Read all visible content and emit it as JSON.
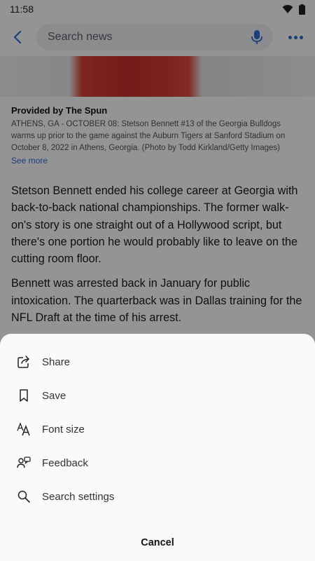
{
  "status_bar": {
    "time": "11:58"
  },
  "header": {
    "search_placeholder": "Search news"
  },
  "caption": {
    "provider": "Provided by The Spun",
    "text": "ATHENS, GA - OCTOBER 08: Stetson Bennett #13 of the Georgia Bulldogs warms up prior to the game against the Auburn Tigers at Sanford Stadium on October 8, 2022 in Athens, Georgia. (Photo by Todd Kirkland/Getty Images)",
    "see_more": "See more"
  },
  "article": {
    "paragraphs": [
      "Stetson Bennett ended his college career at Georgia with back-to-back national championships. The former walk-on's story is one straight out of a Hollywood script, but there's one portion he would probably like to leave on the cutting room floor.",
      "Bennett was arrested back in January for public intoxication. The quarterback was in Dallas training for the NFL Draft at the time of his arrest."
    ]
  },
  "menu": {
    "items": [
      {
        "label": "Share",
        "icon": "share-icon"
      },
      {
        "label": "Save",
        "icon": "bookmark-icon"
      },
      {
        "label": "Font size",
        "icon": "font-size-icon"
      },
      {
        "label": "Feedback",
        "icon": "feedback-icon"
      },
      {
        "label": "Search settings",
        "icon": "search-icon"
      }
    ],
    "cancel": "Cancel"
  },
  "colors": {
    "accent": "#2f6bd8",
    "overlay": "rgba(0,0,0,0.42)",
    "sheet": "#fafafa"
  }
}
